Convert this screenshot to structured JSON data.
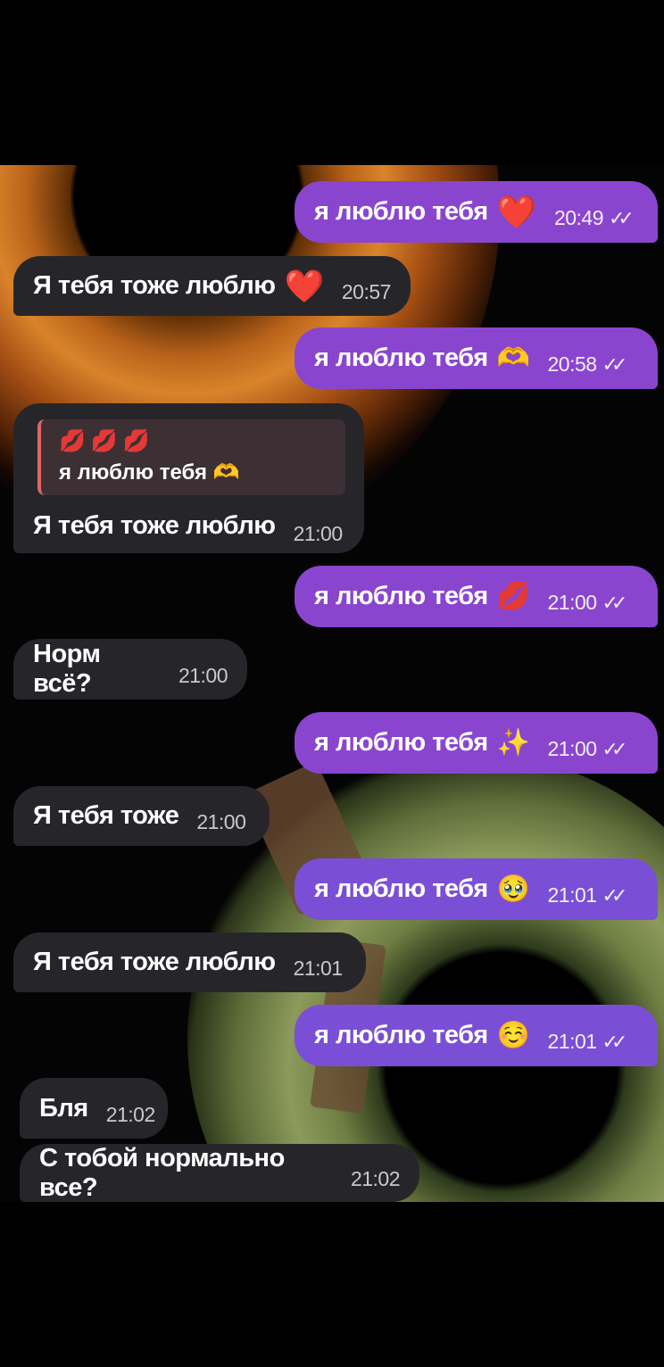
{
  "messages": [
    {
      "text": "я люблю тебя",
      "emoji": "❤️",
      "time": "20:49",
      "direction": "out"
    },
    {
      "text": "Я тебя тоже люблю",
      "emoji": "❤️",
      "time": "20:57",
      "direction": "in"
    },
    {
      "text": "я люблю тебя",
      "emoji": "🫶",
      "time": "20:58",
      "direction": "out"
    },
    {
      "text": "Я тебя тоже люблю",
      "time": "21:00",
      "direction": "in",
      "reply": {
        "emoji": "💋💋💋",
        "text": "я люблю тебя 🫶"
      }
    },
    {
      "text": "я люблю тебя",
      "emoji": "💋",
      "time": "21:00",
      "direction": "out"
    },
    {
      "text": "Норм всё?",
      "time": "21:00",
      "direction": "in"
    },
    {
      "text": "я люблю тебя",
      "emoji": "✨",
      "time": "21:00",
      "direction": "out"
    },
    {
      "text": "Я тебя тоже",
      "time": "21:00",
      "direction": "in"
    },
    {
      "text": "я люблю тебя",
      "emoji": "🥹",
      "time": "21:01",
      "direction": "out"
    },
    {
      "text": "Я тебя тоже люблю",
      "time": "21:01",
      "direction": "in"
    },
    {
      "text": "я люблю тебя",
      "emoji": "☺️",
      "time": "21:01",
      "direction": "out"
    },
    {
      "text": "Бля",
      "time": "21:02",
      "direction": "in"
    },
    {
      "text": "С тобой нормально все?",
      "time": "21:02",
      "direction": "in"
    }
  ],
  "read_mark": "✓✓",
  "colors": {
    "outgoing": "#8a45cf",
    "incoming": "#26262a",
    "background": "#000000"
  }
}
